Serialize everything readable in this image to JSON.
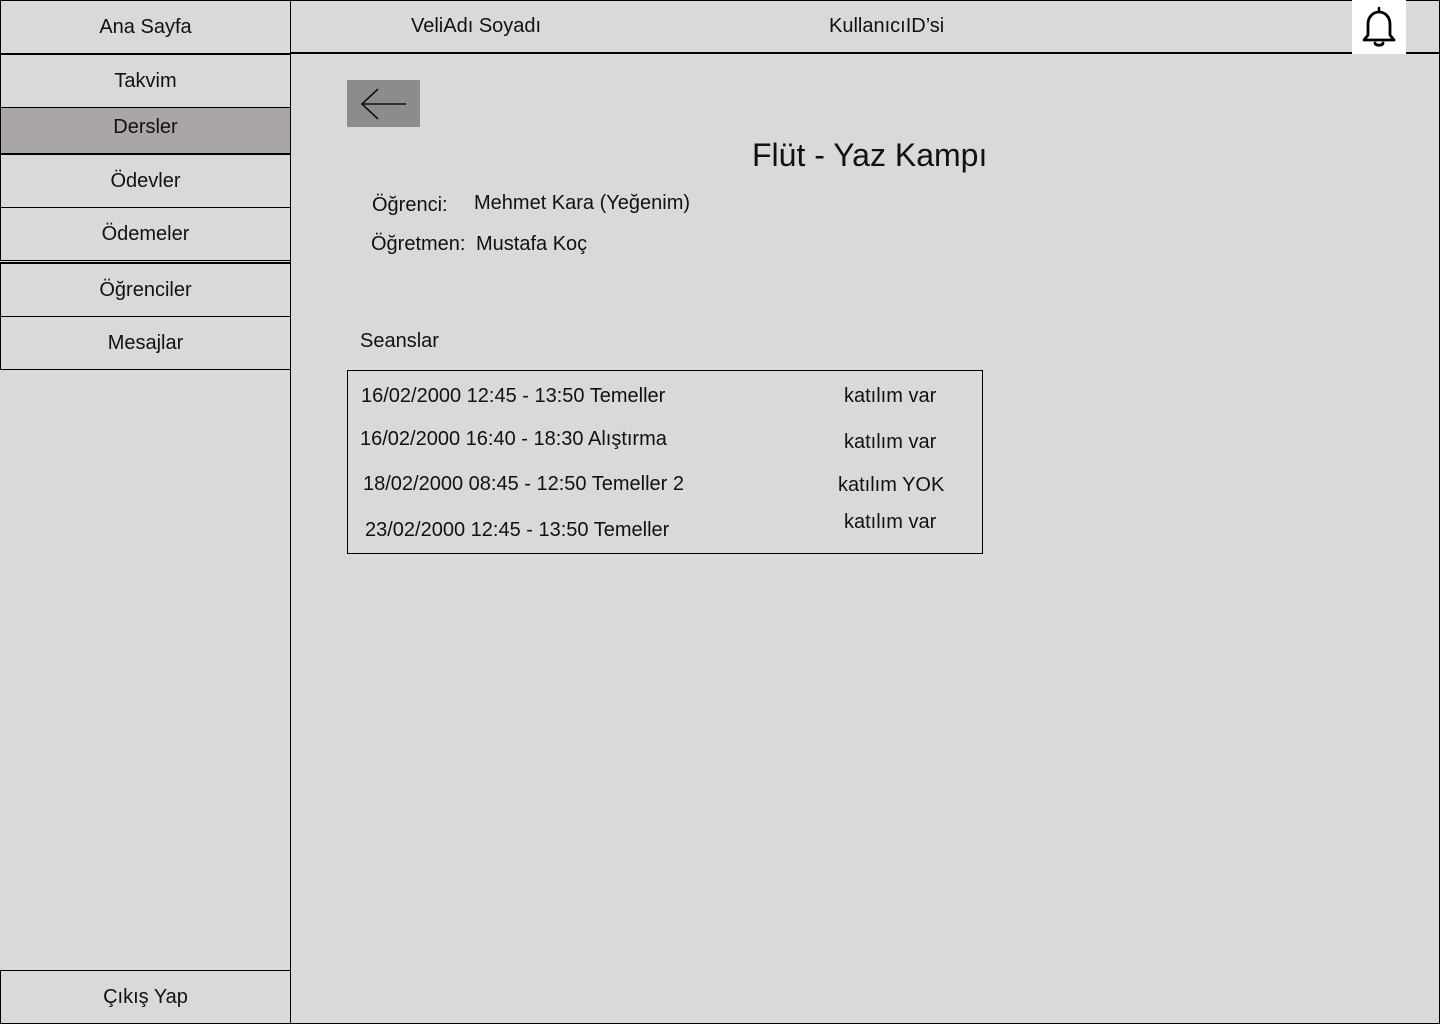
{
  "sidebar": {
    "home_label": "Ana Sayfa",
    "items": [
      {
        "label": "Takvim"
      },
      {
        "label": "Dersler"
      },
      {
        "label": "Ödevler"
      },
      {
        "label": "Ödemeler"
      },
      {
        "label": "Öğrenciler"
      },
      {
        "label": "Mesajlar"
      }
    ],
    "active_item": "Dersler",
    "logout_label": "Çıkış Yap"
  },
  "header": {
    "parent_name": "VeliAdı Soyadı",
    "user_id": "KullanıcıID’si",
    "notification_icon": "bell-icon"
  },
  "main": {
    "back_icon": "arrow-left-icon",
    "title": "Flüt - Yaz Kampı",
    "student_label": "Öğrenci:",
    "student_value": "Mehmet Kara (Yeğenim)",
    "teacher_label": "Öğretmen:",
    "teacher_value": "Mustafa Koç",
    "sessions_heading": "Seanslar",
    "sessions": [
      {
        "text": "16/02/2000 12:45 - 13:50 Temeller",
        "attendance": "katılım var"
      },
      {
        "text": "16/02/2000 16:40 - 18:30 Alıştırma",
        "attendance": "katılım var"
      },
      {
        "text": "18/02/2000 08:45 - 12:50 Temeller 2",
        "attendance": "katılım YOK"
      },
      {
        "text": "23/02/2000 12:45 - 13:50 Temeller",
        "attendance": "katılım var"
      }
    ]
  },
  "colors": {
    "background": "#d9d9d9",
    "active_nav": "#aaa6a6",
    "back_button": "#8e8b8b",
    "bell_background": "#ffffff"
  }
}
